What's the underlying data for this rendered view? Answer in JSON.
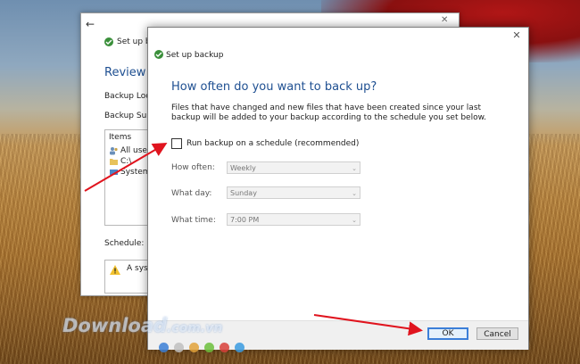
{
  "back_window": {
    "title": "Set up back",
    "heading": "Review yo",
    "backup_location_label": "Backup Locati",
    "backup_summary_label": "Backup Summ",
    "items_header": "Items",
    "items": [
      "All users",
      "C:\\",
      "System im"
    ],
    "schedule_label": "Schedule:",
    "schedule_text": "A syste"
  },
  "dialog": {
    "title": "Set up backup",
    "heading": "How often do you want to back up?",
    "description": "Files that have changed and new files that have been created since your last backup will be added to your backup according to the schedule you set below.",
    "checkbox_label": "Run backup on a schedule (recommended)",
    "checkbox_checked": false,
    "how_often_label": "How often:",
    "how_often_value": "Weekly",
    "what_day_label": "What day:",
    "what_day_value": "Sunday",
    "what_time_label": "What time:",
    "what_time_value": "7:00 PM",
    "ok_label": "OK",
    "cancel_label": "Cancel"
  },
  "watermark": {
    "brand": "Download",
    "suffix": ".com.vn"
  },
  "colors": {
    "heading_blue": "#1e4f91",
    "annotation_red": "#e0141e",
    "ok_border": "#3c7fd8"
  }
}
